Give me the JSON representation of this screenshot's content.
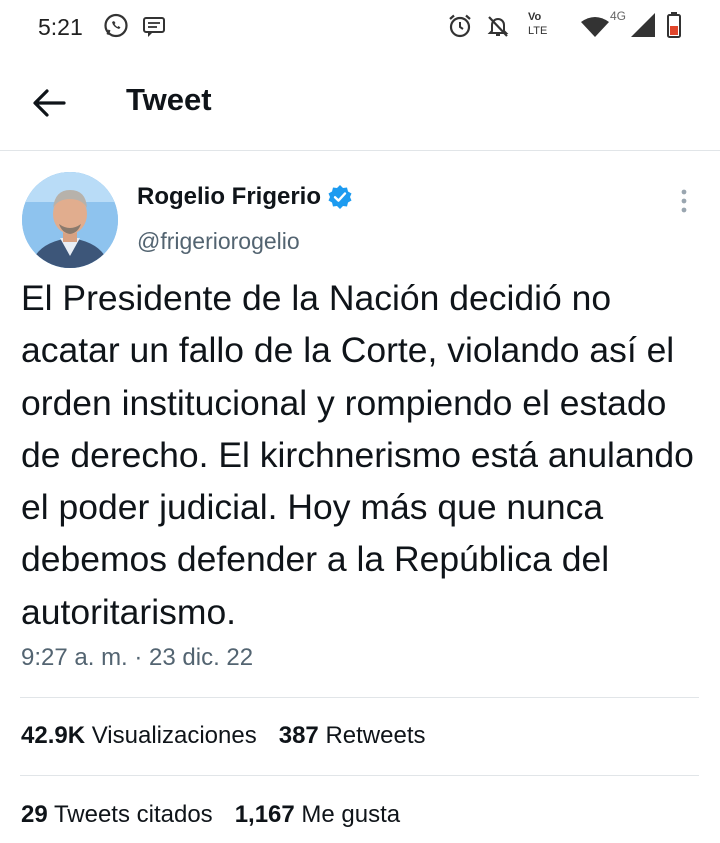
{
  "status_bar": {
    "time": "5:21",
    "icons": [
      "whatsapp-icon",
      "message-icon",
      "alarm-icon",
      "mute-icon",
      "volte-icon",
      "wifi-icon",
      "signal-icon",
      "battery-icon"
    ],
    "volte_top": "Vo",
    "volte_bottom": "LTE",
    "network": "4G"
  },
  "header": {
    "back_icon": "arrow-left-icon",
    "title": "Tweet"
  },
  "tweet": {
    "author_name": "Rogelio Frigerio",
    "author_handle": "@frigeriorogelio",
    "text": "El Presidente de la Nación decidió no acatar un fallo de la Corte, violando así el orden institucional y rompiendo el estado de derecho. El kirchnerismo está anulando el poder judicial. Hoy más que nunca debemos defender a la República del autoritarismo.",
    "timestamp": "9:27 a. m. · 23 dic. 22"
  },
  "stats": {
    "views_count": "42.9K",
    "views_label": "Visualizaciones",
    "retweets_count": "387",
    "retweets_label": "Retweets",
    "quotes_count": "29",
    "quotes_label": "Tweets citados",
    "likes_count": "1,167",
    "likes_label": "Me gusta"
  },
  "colors": {
    "verified": "#1d9bf0",
    "secondary_text": "#536471",
    "divider": "#e1e5e8"
  }
}
